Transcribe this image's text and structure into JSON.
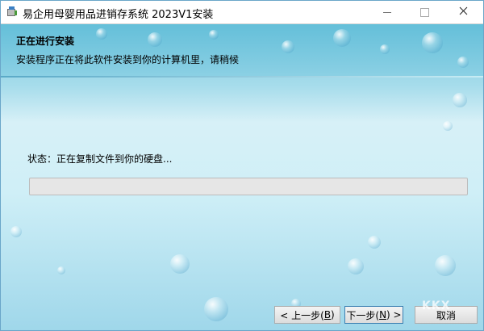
{
  "window": {
    "title": "易企用母婴用品进销存系统 2023V1安装"
  },
  "header": {
    "title": "正在进行安装",
    "subtitle": "安装程序正在将此软件安装到你的计算机里，请稍候"
  },
  "status": {
    "text": "状态：正在复制文件到你的硬盘..."
  },
  "progress": {
    "percent": 0
  },
  "buttons": {
    "back": {
      "prefix": "< 上一步(",
      "key": "B",
      "suffix": ")"
    },
    "next": {
      "prefix": "下一步(",
      "key": "N",
      "suffix": ") >"
    },
    "cancel": {
      "label": "取消"
    }
  },
  "watermark": {
    "text": "KKX"
  },
  "colors": {
    "accent": "#3c7fb1",
    "progress_fill": "#06b025",
    "header_band": "#64bfd9"
  },
  "icons": {
    "app": "installer-package-icon",
    "minimize": "minimize-icon",
    "maximize": "maximize-icon",
    "close": "close-icon"
  }
}
